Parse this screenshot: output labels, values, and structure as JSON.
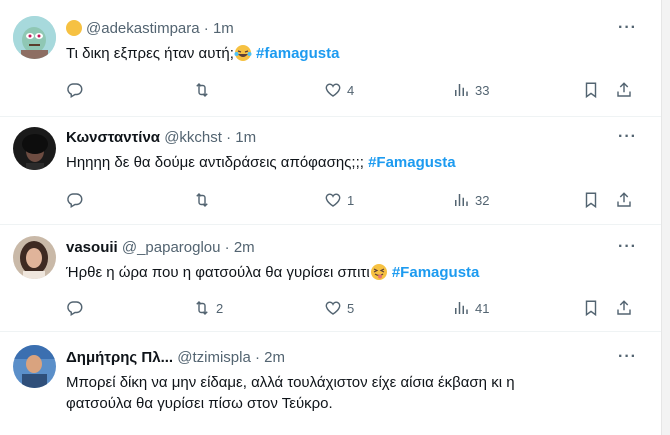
{
  "tweets": [
    {
      "name": "",
      "handle": "@adekastimpara",
      "time": "1m",
      "text_before": "Τι δικη εξπρες ήταν αυτή;",
      "hashtag": "#famagusta",
      "replies": "",
      "retweets": "",
      "likes": "4",
      "views": "33"
    },
    {
      "name": "Κωνσταντίνα",
      "handle": "@kkchst",
      "time": "1m",
      "text_before": "Ηηηηη δε θα δούμε αντιδράσεις απόφασης;;; ",
      "hashtag": "#Famagusta",
      "replies": "",
      "retweets": "",
      "likes": "1",
      "views": "32"
    },
    {
      "name": "vasouii",
      "handle": "@_paparoglou",
      "time": "2m",
      "text_before": "Ήρθε η ώρα που η φατσούλα θα γυρίσει σπιτι",
      "hashtag": "#Famagusta",
      "replies": "",
      "retweets": "2",
      "likes": "5",
      "views": "41"
    },
    {
      "name": "Δημήτρης Πλ...",
      "handle": "@tzimispla",
      "time": "2m",
      "text_line1": "Μπορεί δίκη να μην είδαμε, αλλά τουλάχιστον είχε αίσια έκβαση κι η",
      "text_line2": "φατσούλα θα γυρίσει πίσω στον Τεύκρο."
    }
  ],
  "separator": "·",
  "more_label": "···",
  "colors": {
    "hashtag": "#1d9bf0",
    "muted": "#536471",
    "text": "#0f1419"
  },
  "icons": [
    "reply-icon",
    "retweet-icon",
    "like-icon",
    "views-icon",
    "bookmark-icon",
    "share-icon",
    "more-icon"
  ]
}
